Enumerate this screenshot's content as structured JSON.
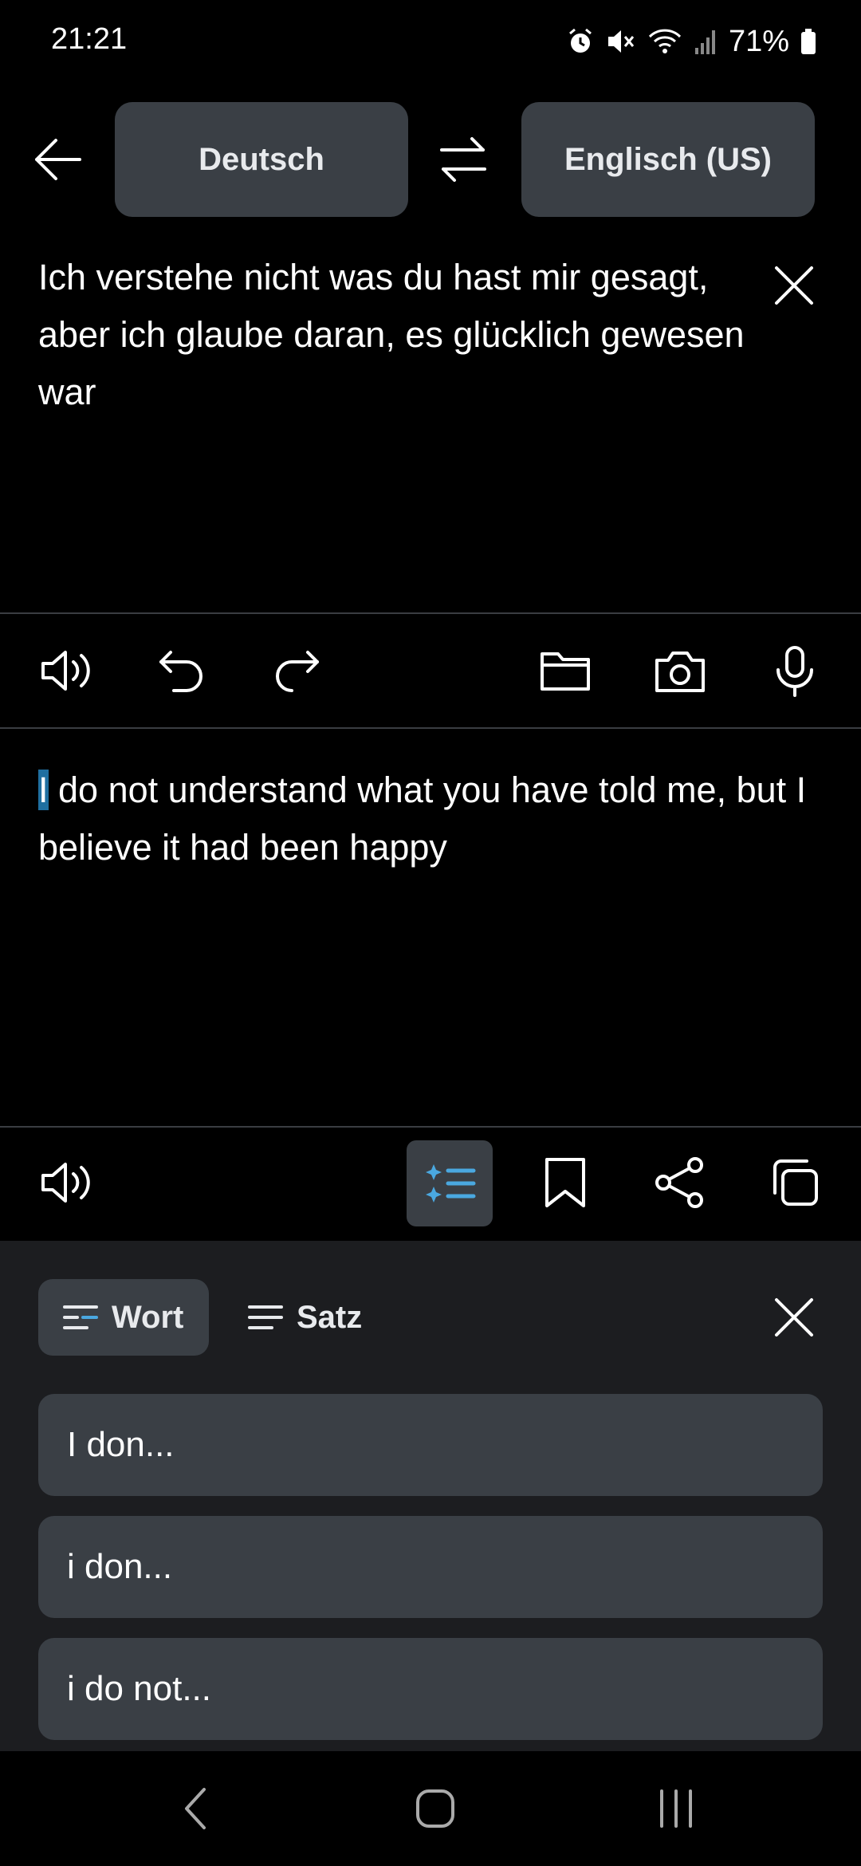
{
  "status_bar": {
    "time": "21:21",
    "battery": "71%",
    "icons": [
      "alarm-icon",
      "mute-icon",
      "wifi-icon",
      "signal-icon",
      "battery-icon"
    ]
  },
  "language_bar": {
    "source_language": "Deutsch",
    "target_language": "Englisch (US)"
  },
  "source": {
    "text": "Ich verstehe nicht was du hast mir gesagt, aber ich glaube daran, es glücklich gewesen war"
  },
  "translation": {
    "first_word": "I",
    "rest": " do not understand what you have told me, but I believe it had been happy"
  },
  "suggestions_panel": {
    "tab_word": "Wort",
    "tab_sentence": "Satz",
    "items": [
      "I don...",
      "i don...",
      "i do not..."
    ]
  },
  "colors": {
    "background": "#000000",
    "button_bg": "#3a3f45",
    "panel_bg": "#1c1d20",
    "accent": "#4aa8e0"
  }
}
